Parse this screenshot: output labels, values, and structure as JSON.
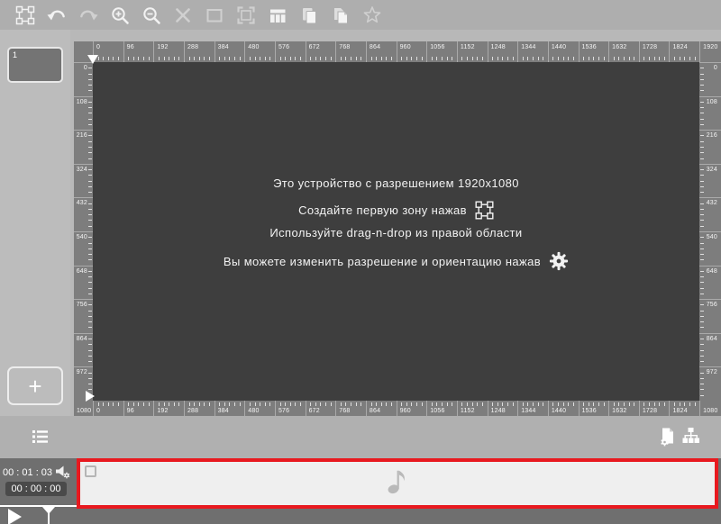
{
  "toolbar": {
    "icons": [
      {
        "id": "create-zone",
        "enabled": true
      },
      {
        "id": "undo",
        "enabled": true
      },
      {
        "id": "redo",
        "enabled": false
      },
      {
        "id": "zoom-in",
        "enabled": true
      },
      {
        "id": "zoom-out",
        "enabled": true
      },
      {
        "id": "delete",
        "enabled": false
      },
      {
        "id": "rectangle",
        "enabled": false
      },
      {
        "id": "fit-selection",
        "enabled": false
      },
      {
        "id": "split-columns",
        "enabled": true
      },
      {
        "id": "copy",
        "enabled": true
      },
      {
        "id": "paste",
        "enabled": true
      },
      {
        "id": "favorites",
        "enabled": false
      }
    ]
  },
  "sidebar": {
    "page_label": "1",
    "add_page_label": "+"
  },
  "editor": {
    "ruler_horizontal": [
      "0",
      "96",
      "192",
      "288",
      "384",
      "480",
      "576",
      "672",
      "768",
      "864",
      "960",
      "1056",
      "1152",
      "1248",
      "1344",
      "1440",
      "1536",
      "1632",
      "1728",
      "1824",
      "1920"
    ],
    "ruler_vertical": [
      "0",
      "108",
      "216",
      "324",
      "432",
      "540",
      "648",
      "756",
      "864",
      "972",
      "1080"
    ],
    "hints": {
      "line1": "Это устройство с разрешением 1920x1080",
      "line2": "Создайте первую зону нажав",
      "line3": "Используйте drag-n-drop из правой области",
      "line4": "Вы можете изменить разрешение и ориентацию нажав"
    }
  },
  "timeline": {
    "total_time": "00 : 01 : 03",
    "current_time": "00 : 00 : 00"
  },
  "colors": {
    "accent_red": "#e8191f",
    "canvas_bg": "#3e3e3e",
    "ruler_bg": "#7d7d7d"
  }
}
